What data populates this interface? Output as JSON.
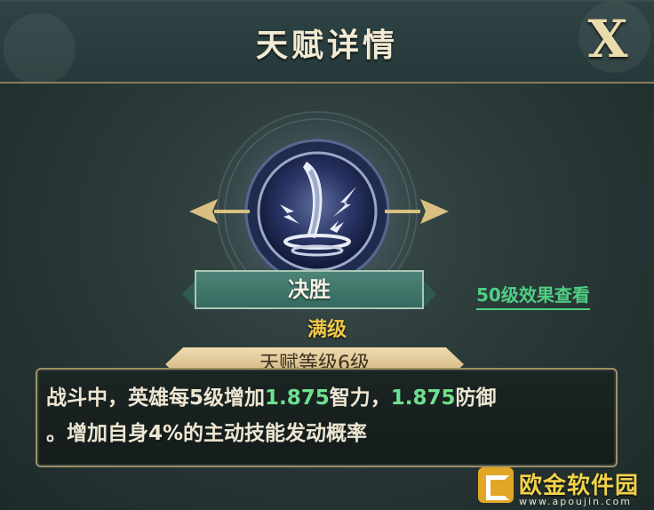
{
  "header": {
    "title": "天赋详情",
    "close_label": "X"
  },
  "talent": {
    "icon": "lightning-slash-icon",
    "name": "决胜",
    "status": "满级",
    "level_label": "天赋等级6级",
    "level50_link": "50级效果查看"
  },
  "description": {
    "part1": "战斗中，英雄每5级增加",
    "value1": "1.875",
    "part2": "智力，",
    "value2": "1.875",
    "part3": "防御",
    "line2": "。增加自身4%的主动技能发动概率"
  },
  "watermark": {
    "name": "欧金软件园",
    "url": "www.apoujin.com"
  },
  "colors": {
    "highlight": "#6fe08f",
    "gold": "#efc94a",
    "link": "#4fcf83",
    "banner": "#4d8378"
  }
}
